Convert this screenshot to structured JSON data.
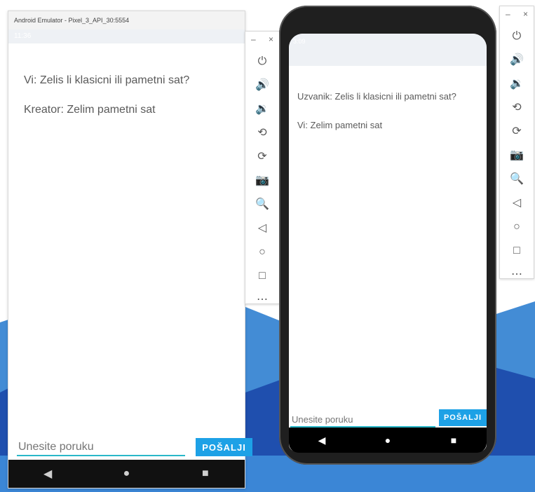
{
  "left_emulator": {
    "window_title": "Android Emulator - Pixel_3_API_30:5554",
    "status_time": "11:36",
    "messages": [
      "Vi: Zelis li klasicni ili pametni sat?",
      "Kreator: Zelim pametni sat"
    ],
    "input_placeholder": "Unesite poruku",
    "send_label": "POŠALJI"
  },
  "right_emulator": {
    "status_time": "3:09",
    "messages": [
      "Uzvanik: Zelis li klasicni ili pametni sat?",
      "Vi: Zelim pametni sat"
    ],
    "input_placeholder": "Unesite poruku",
    "send_label": "POŠALJI"
  },
  "toolbar": {
    "window_controls": [
      "–",
      "×"
    ],
    "icons": [
      "power-icon",
      "volume-up-icon",
      "volume-down-icon",
      "rotate-left-icon",
      "rotate-right-icon",
      "camera-icon",
      "zoom-icon",
      "back-icon",
      "home-icon",
      "overview-icon",
      "more-icon"
    ],
    "glyphs": [
      "⏻",
      "🔊",
      "🔉",
      "⟲",
      "⟳",
      "📷",
      "🔍",
      "◁",
      "○",
      "□",
      "⋯"
    ]
  },
  "nav": {
    "back": "◀",
    "home": "●",
    "recents": "■"
  }
}
